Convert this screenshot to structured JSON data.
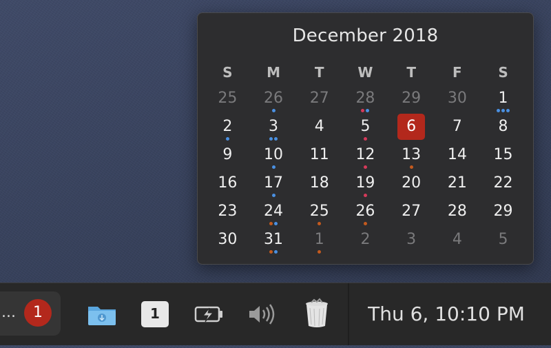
{
  "calendar": {
    "title": "December 2018",
    "weekdays": [
      "S",
      "M",
      "T",
      "W",
      "T",
      "F",
      "S"
    ],
    "today": "6",
    "dot_colors": {
      "blue": "#4a90e2",
      "red": "#d63a5a",
      "orange": "#c45a1e"
    },
    "weeks": [
      [
        {
          "d": "25",
          "out": true
        },
        {
          "d": "26",
          "out": true,
          "dots": [
            "blue"
          ]
        },
        {
          "d": "27",
          "out": true
        },
        {
          "d": "28",
          "out": true,
          "dots": [
            "red",
            "blue"
          ]
        },
        {
          "d": "29",
          "out": true
        },
        {
          "d": "30",
          "out": true
        },
        {
          "d": "1",
          "dots": [
            "blue",
            "blue",
            "blue"
          ]
        }
      ],
      [
        {
          "d": "2",
          "dots": [
            "blue"
          ]
        },
        {
          "d": "3",
          "dots": [
            "blue",
            "blue"
          ]
        },
        {
          "d": "4"
        },
        {
          "d": "5",
          "dots": [
            "red"
          ]
        },
        {
          "d": "6",
          "today": true
        },
        {
          "d": "7"
        },
        {
          "d": "8"
        }
      ],
      [
        {
          "d": "9"
        },
        {
          "d": "10",
          "dots": [
            "blue"
          ]
        },
        {
          "d": "11"
        },
        {
          "d": "12",
          "dots": [
            "red"
          ]
        },
        {
          "d": "13",
          "dots": [
            "orange"
          ]
        },
        {
          "d": "14"
        },
        {
          "d": "15"
        }
      ],
      [
        {
          "d": "16"
        },
        {
          "d": "17",
          "dots": [
            "blue"
          ]
        },
        {
          "d": "18"
        },
        {
          "d": "19",
          "dots": [
            "red"
          ]
        },
        {
          "d": "20"
        },
        {
          "d": "21"
        },
        {
          "d": "22"
        }
      ],
      [
        {
          "d": "23"
        },
        {
          "d": "24",
          "dots": [
            "orange",
            "blue"
          ]
        },
        {
          "d": "25",
          "dots": [
            "orange"
          ]
        },
        {
          "d": "26",
          "dots": [
            "orange"
          ]
        },
        {
          "d": "27"
        },
        {
          "d": "28"
        },
        {
          "d": "29"
        }
      ],
      [
        {
          "d": "30"
        },
        {
          "d": "31",
          "dots": [
            "orange",
            "blue"
          ]
        },
        {
          "d": "1",
          "out": true,
          "dots": [
            "orange"
          ]
        },
        {
          "d": "2",
          "out": true
        },
        {
          "d": "3",
          "out": true
        },
        {
          "d": "4",
          "out": true
        },
        {
          "d": "5",
          "out": true
        }
      ]
    ]
  },
  "dock": {
    "overflow_label": "...",
    "notification_count": "1",
    "workspace_number": "1",
    "icons": [
      "downloads-folder-icon",
      "workspace-icon",
      "battery-charging-icon",
      "volume-icon",
      "trash-icon"
    ],
    "clock": "Thu 6, 10:10 PM"
  }
}
